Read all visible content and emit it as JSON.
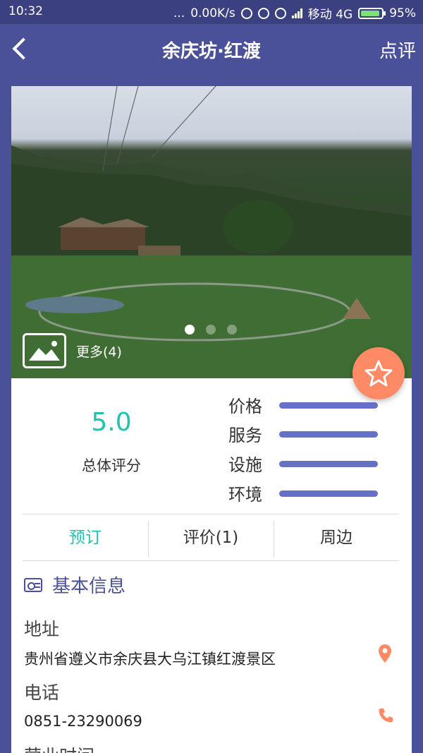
{
  "status_bar": {
    "time": "10:32",
    "dots": "...",
    "speed": "0.00K/s",
    "carrier": "移动 4G",
    "battery": "95%"
  },
  "nav": {
    "title": "余庆坊·红渡",
    "action_label": "点评",
    "back_icon": "chevron-left-icon"
  },
  "gallery": {
    "more_label": "更多(4)",
    "pages": 3,
    "active_page": 1
  },
  "rating": {
    "overall_score": "5.0",
    "overall_label": "总体评分",
    "categories": [
      {
        "label": "价格",
        "level": 1.0
      },
      {
        "label": "服务",
        "level": 1.0
      },
      {
        "label": "设施",
        "level": 1.0
      },
      {
        "label": "环境",
        "level": 1.0
      }
    ]
  },
  "tabs": [
    {
      "label": "预订",
      "active": true
    },
    {
      "label": "评价(1)",
      "active": false
    },
    {
      "label": "周边",
      "active": false
    }
  ],
  "info": {
    "section_title": "基本信息",
    "address_label": "地址",
    "address": "贵州省遵义市余庆县大乌江镇红渡景区",
    "phone_label": "电话",
    "phone": "0851-23290069",
    "hours_label": "营业时间"
  },
  "colors": {
    "primary": "#4a5199",
    "accent": "#1fc3b0",
    "favorite": "#ff8a65",
    "bar": "#6670c6"
  }
}
